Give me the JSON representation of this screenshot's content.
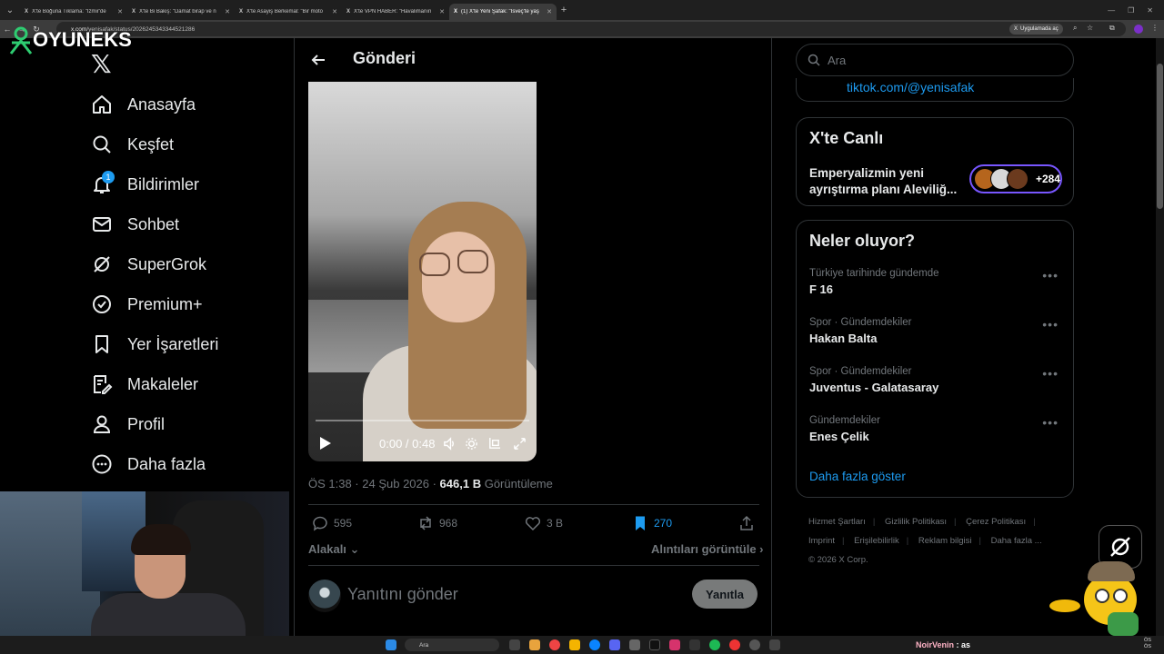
{
  "browser": {
    "tabs": [
      {
        "label": "X'te Boğuna Tıklama: \"İzmir'de",
        "active": false
      },
      {
        "label": "X'te Bi Bakiş: \"Damat birap ve n",
        "active": false
      },
      {
        "label": "X'te Asayiş Berkemal: \"Bir moto",
        "active": false
      },
      {
        "label": "X'te VPN HABER: \"Havalimanın",
        "active": false
      },
      {
        "label": "(1) X'te Yeni Şafak: \"İsveç'te yaş",
        "active": true
      }
    ],
    "url_site": "x.com",
    "url_path": "/yenisafak/status/2026245343344521286",
    "open_app": "Uygulamada aç"
  },
  "overlay": {
    "logo_text": "OYUNEKS"
  },
  "nav": {
    "items": [
      {
        "label": "Anasayfa",
        "icon": "home-icon"
      },
      {
        "label": "Keşfet",
        "icon": "search-icon"
      },
      {
        "label": "Bildirimler",
        "icon": "bell-icon"
      },
      {
        "label": "Sohbet",
        "icon": "mail-icon"
      },
      {
        "label": "SuperGrok",
        "icon": "grok-icon"
      },
      {
        "label": "Premium+",
        "icon": "verified-icon"
      },
      {
        "label": "Yer İşaretleri",
        "icon": "bookmark-icon"
      },
      {
        "label": "Makaleler",
        "icon": "article-icon"
      },
      {
        "label": "Profil",
        "icon": "profile-icon"
      },
      {
        "label": "Daha fazla",
        "icon": "more-icon"
      }
    ],
    "notification_count": "1"
  },
  "post": {
    "title": "Gönderi",
    "video_time": "0:00 / 0:48",
    "meta_time": "ÖS 1:38 · 24 Şub 2026 · ",
    "views": "646,1 B",
    "views_label": " Görüntüleme",
    "stats": {
      "replies": "595",
      "reposts": "968",
      "likes": "3 B",
      "bookmarks": "270"
    },
    "sort_label": "Alakalı",
    "quotes_label": "Alıntıları görüntüle",
    "reply_placeholder": "Yanıtını gönder",
    "reply_button": "Yanıtla"
  },
  "sidebar": {
    "search_placeholder": "Ara",
    "tiktok_link": "tiktok.com/@yenisafak",
    "live": {
      "title": "X'te Canlı",
      "text": "Emperyalizmin yeni ayrıştırma planı Aleviliğ...",
      "count": "+284"
    },
    "trends": {
      "title": "Neler oluyor?",
      "items": [
        {
          "context": "Türkiye tarihinde gündemde",
          "name": "F 16"
        },
        {
          "context": "Spor · Gündemdekiler",
          "name": "Hakan Balta"
        },
        {
          "context": "Spor · Gündemdekiler",
          "name": "Juventus - Galatasaray"
        },
        {
          "context": "Gündemdekiler",
          "name": "Enes Çelik"
        }
      ],
      "more": "Daha fazla göster"
    },
    "footer": {
      "links": [
        "Hizmet Şartları",
        "Gizlilik Politikası",
        "Çerez Politikası",
        "Imprint",
        "Erişilebilirlik",
        "Reklam bilgisi",
        "Daha fazla ..."
      ],
      "copyright": "© 2026 X Corp."
    }
  },
  "taskbar": {
    "search": "Ara",
    "chat_user": "NoirVenin",
    "chat_message": "as",
    "clock_time": "ÖS",
    "clock_date": "ÖS"
  }
}
